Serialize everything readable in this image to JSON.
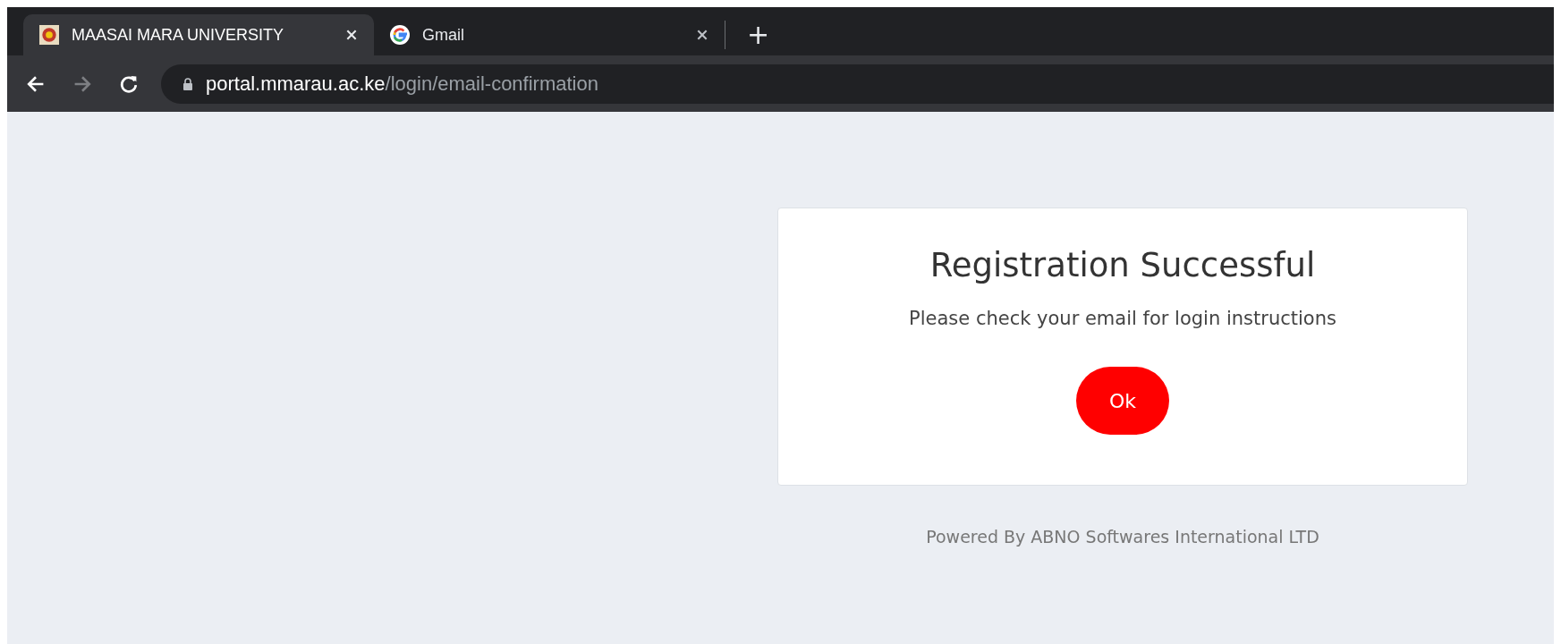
{
  "tabs": [
    {
      "title": "MAASAI MARA UNIVERSITY",
      "selected": true
    },
    {
      "title": "Gmail",
      "selected": false
    }
  ],
  "new_tab": "+",
  "address": {
    "host": "portal.mmarau.ac.ke",
    "path": "/login/email-confirmation"
  },
  "card": {
    "title": "Registration Successful",
    "message": "Please check your email for login instructions",
    "button": "Ok"
  },
  "footer": "Powered By ABNO Softwares International LTD"
}
